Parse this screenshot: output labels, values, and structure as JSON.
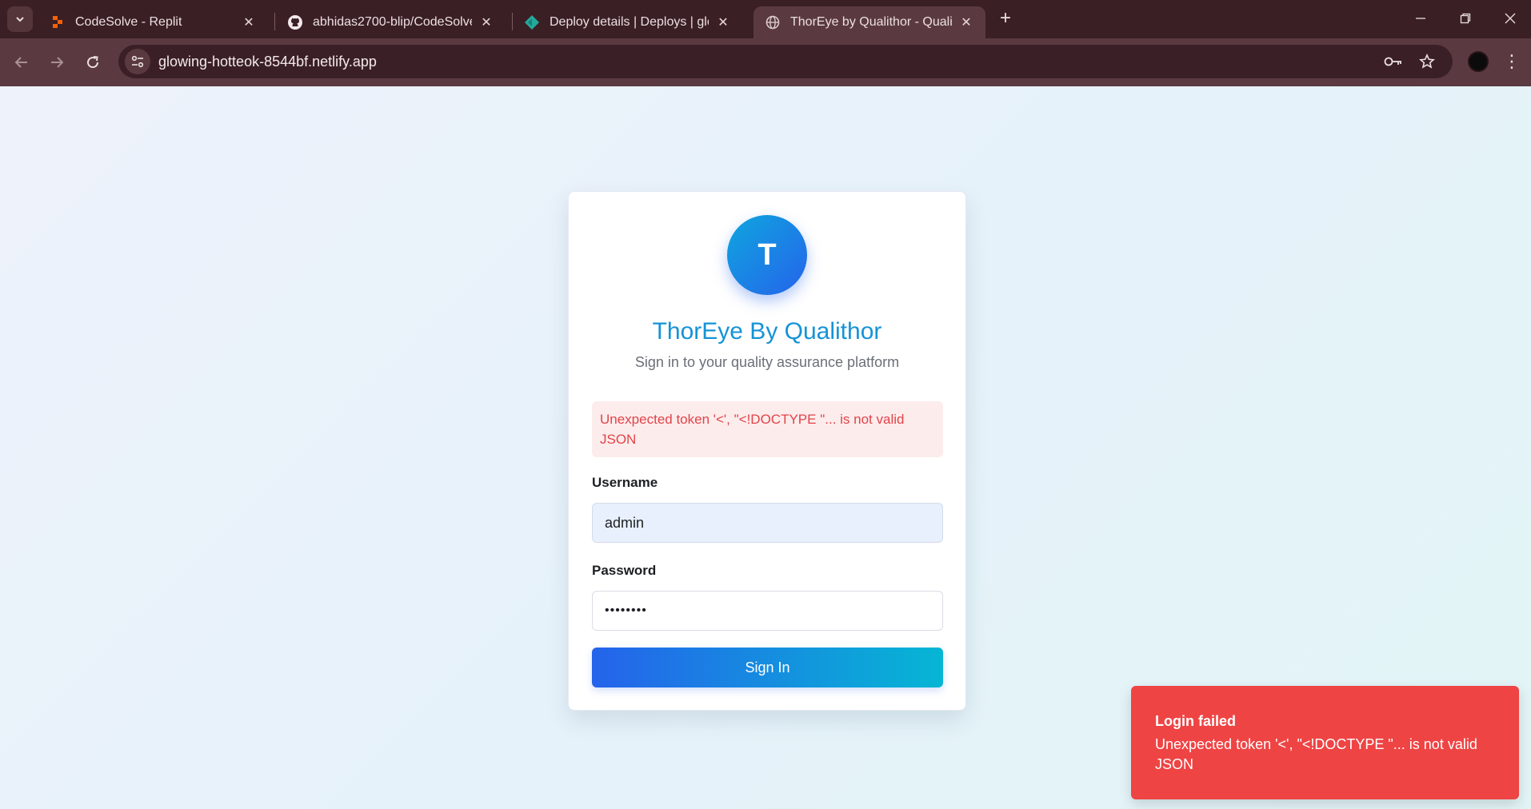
{
  "browser": {
    "tabs": [
      {
        "title": "CodeSolve - Replit",
        "icon": "replit-icon"
      },
      {
        "title": "abhidas2700-blip/CodeSolve",
        "icon": "github-icon"
      },
      {
        "title": "Deploy details | Deploys | glowin",
        "icon": "netlify-icon"
      },
      {
        "title": "ThorEye by Qualithor - Quality A",
        "icon": "globe-icon",
        "active": true
      }
    ],
    "url": "glowing-hotteok-8544bf.netlify.app"
  },
  "login": {
    "logo_letter": "T",
    "brand": "ThorEye By Qualithor",
    "tagline": "Sign in to your quality assurance platform",
    "error": "Unexpected token '<', \"<!DOCTYPE \"... is not valid JSON",
    "username_label": "Username",
    "username_value": "admin",
    "password_label": "Password",
    "password_value": "••••••••",
    "signin_label": "Sign In"
  },
  "toast": {
    "title": "Login failed",
    "message": "Unexpected token '<', \"<!DOCTYPE \"... is not valid JSON"
  },
  "colors": {
    "brand": "#1593d6",
    "error_text": "#e0444a",
    "error_bg": "#fdecec",
    "toast_bg": "#ef4444",
    "button_start": "#2563eb",
    "button_end": "#06b6d4"
  }
}
